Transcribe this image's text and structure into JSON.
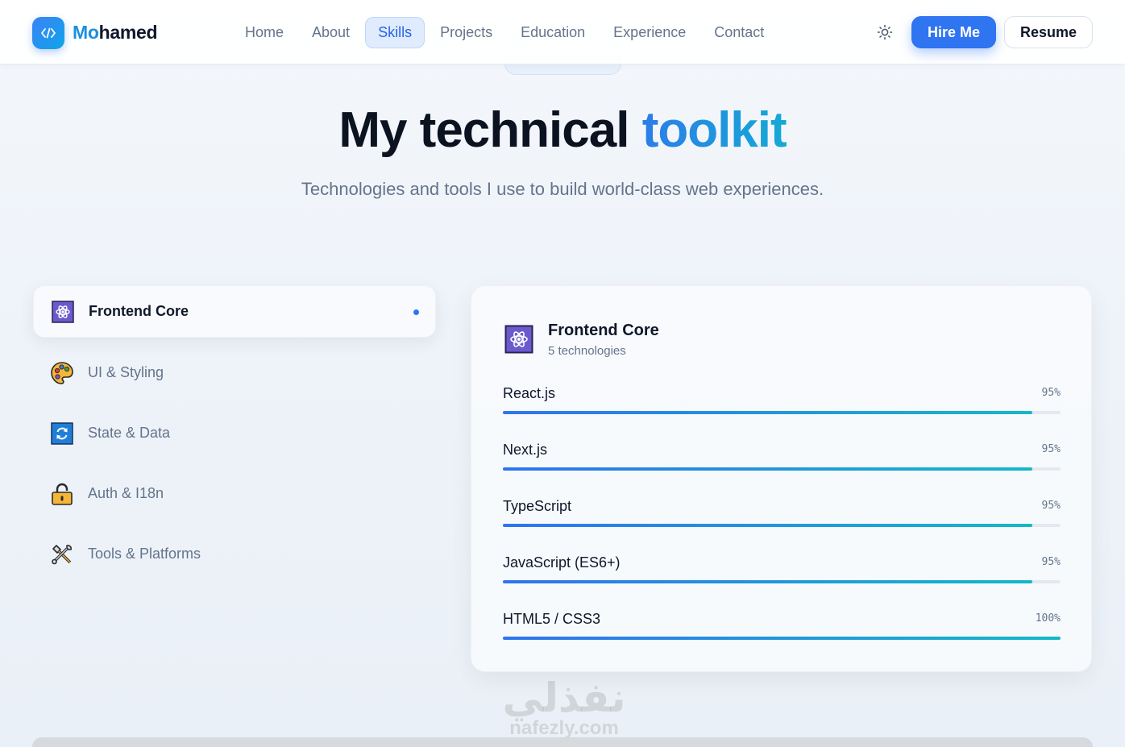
{
  "brand": {
    "prefix": "Mo",
    "rest": "hamed"
  },
  "nav": {
    "links": [
      "Home",
      "About",
      "Skills",
      "Projects",
      "Education",
      "Experience",
      "Contact"
    ],
    "active_link": "Skills",
    "hire_label": "Hire Me",
    "resume_label": "Resume"
  },
  "hero": {
    "title_main": "My technical ",
    "title_accent": "toolkit",
    "subtitle": "Technologies and tools I use to build world-class web experiences."
  },
  "categories": [
    {
      "label": "Frontend Core",
      "icon": "atom-icon",
      "active": true
    },
    {
      "label": "UI & Styling",
      "icon": "palette-icon",
      "active": false
    },
    {
      "label": "State & Data",
      "icon": "refresh-icon",
      "active": false
    },
    {
      "label": "Auth & I18n",
      "icon": "lock-icon",
      "active": false
    },
    {
      "label": "Tools & Platforms",
      "icon": "tools-icon",
      "active": false
    }
  ],
  "panel": {
    "title": "Frontend Core",
    "count": "5 technologies",
    "skills": [
      {
        "name": "React.js",
        "percent_label": "95%",
        "level": 95
      },
      {
        "name": "Next.js",
        "percent_label": "95%",
        "level": 95
      },
      {
        "name": "TypeScript",
        "percent_label": "95%",
        "level": 95
      },
      {
        "name": "JavaScript (ES6+)",
        "percent_label": "95%",
        "level": 95
      },
      {
        "name": "HTML5 / CSS3",
        "percent_label": "100%",
        "level": 100
      }
    ]
  },
  "watermark": {
    "arabic": "نفذلي",
    "latin": "nafezly.com"
  },
  "colors": {
    "accent": "#2f74f0",
    "accent_cyan": "#14a9d6",
    "text": "#0f172a",
    "muted": "#64748b"
  }
}
